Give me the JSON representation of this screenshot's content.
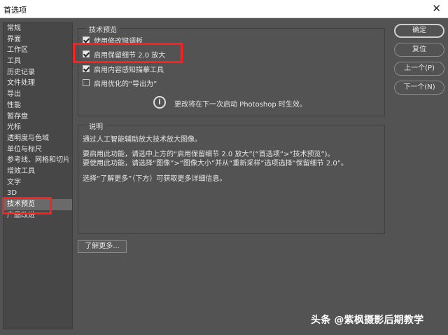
{
  "window": {
    "title": "首选项",
    "close_glyph": "✕"
  },
  "sidebar": {
    "items": [
      {
        "label": "常规",
        "active": false
      },
      {
        "label": "界面",
        "active": false
      },
      {
        "label": "工作区",
        "active": false
      },
      {
        "label": "工具",
        "active": false
      },
      {
        "label": "历史记录",
        "active": false
      },
      {
        "label": "文件处理",
        "active": false
      },
      {
        "label": "导出",
        "active": false
      },
      {
        "label": "性能",
        "active": false
      },
      {
        "label": "暂存盘",
        "active": false
      },
      {
        "label": "光标",
        "active": false
      },
      {
        "label": "透明度与色域",
        "active": false
      },
      {
        "label": "单位与标尺",
        "active": false
      },
      {
        "label": "参考线、网格和切片",
        "active": false
      },
      {
        "label": "增效工具",
        "active": false
      },
      {
        "label": "文字",
        "active": false
      },
      {
        "label": "3D",
        "active": false
      },
      {
        "label": "技术预览",
        "active": true
      },
      {
        "label": "产品改进",
        "active": false
      }
    ]
  },
  "tech_preview": {
    "legend": "技术预览",
    "options": [
      {
        "label": "使用修改键调板",
        "checked": true
      },
      {
        "label": "启用保留细节 2.0 放大",
        "checked": true
      },
      {
        "label": "启用内容感知描摹工具",
        "checked": true
      },
      {
        "label": "启用优化的“导出为”",
        "checked": false
      }
    ],
    "restart_note": "更改将在下一次启动 Photoshop 时生效。",
    "info_icon": "info-circle-icon"
  },
  "description": {
    "legend": "说明",
    "lines": [
      "通过人工智能辅助放大技术放大图像。",
      "要启用此功能，请选中上方的“启用保留细节 2.0 放大”(“首选项”>“技术预览”)。",
      "要使用此功能，请选择“图像”>“图像大小”并从“重新采样”选项选择“保留细节 2.0”。",
      "选择“了解更多”（下方）可获取更多详细信息。"
    ]
  },
  "buttons": {
    "ok": "确定",
    "reset": "复位",
    "prev": "上一个(P)",
    "next": "下一个(N)",
    "learn_more": "了解更多..."
  },
  "watermark": "头条 @紫枫摄影后期教学",
  "colors": {
    "highlight": "#ff1f1f",
    "background": "#535353"
  }
}
